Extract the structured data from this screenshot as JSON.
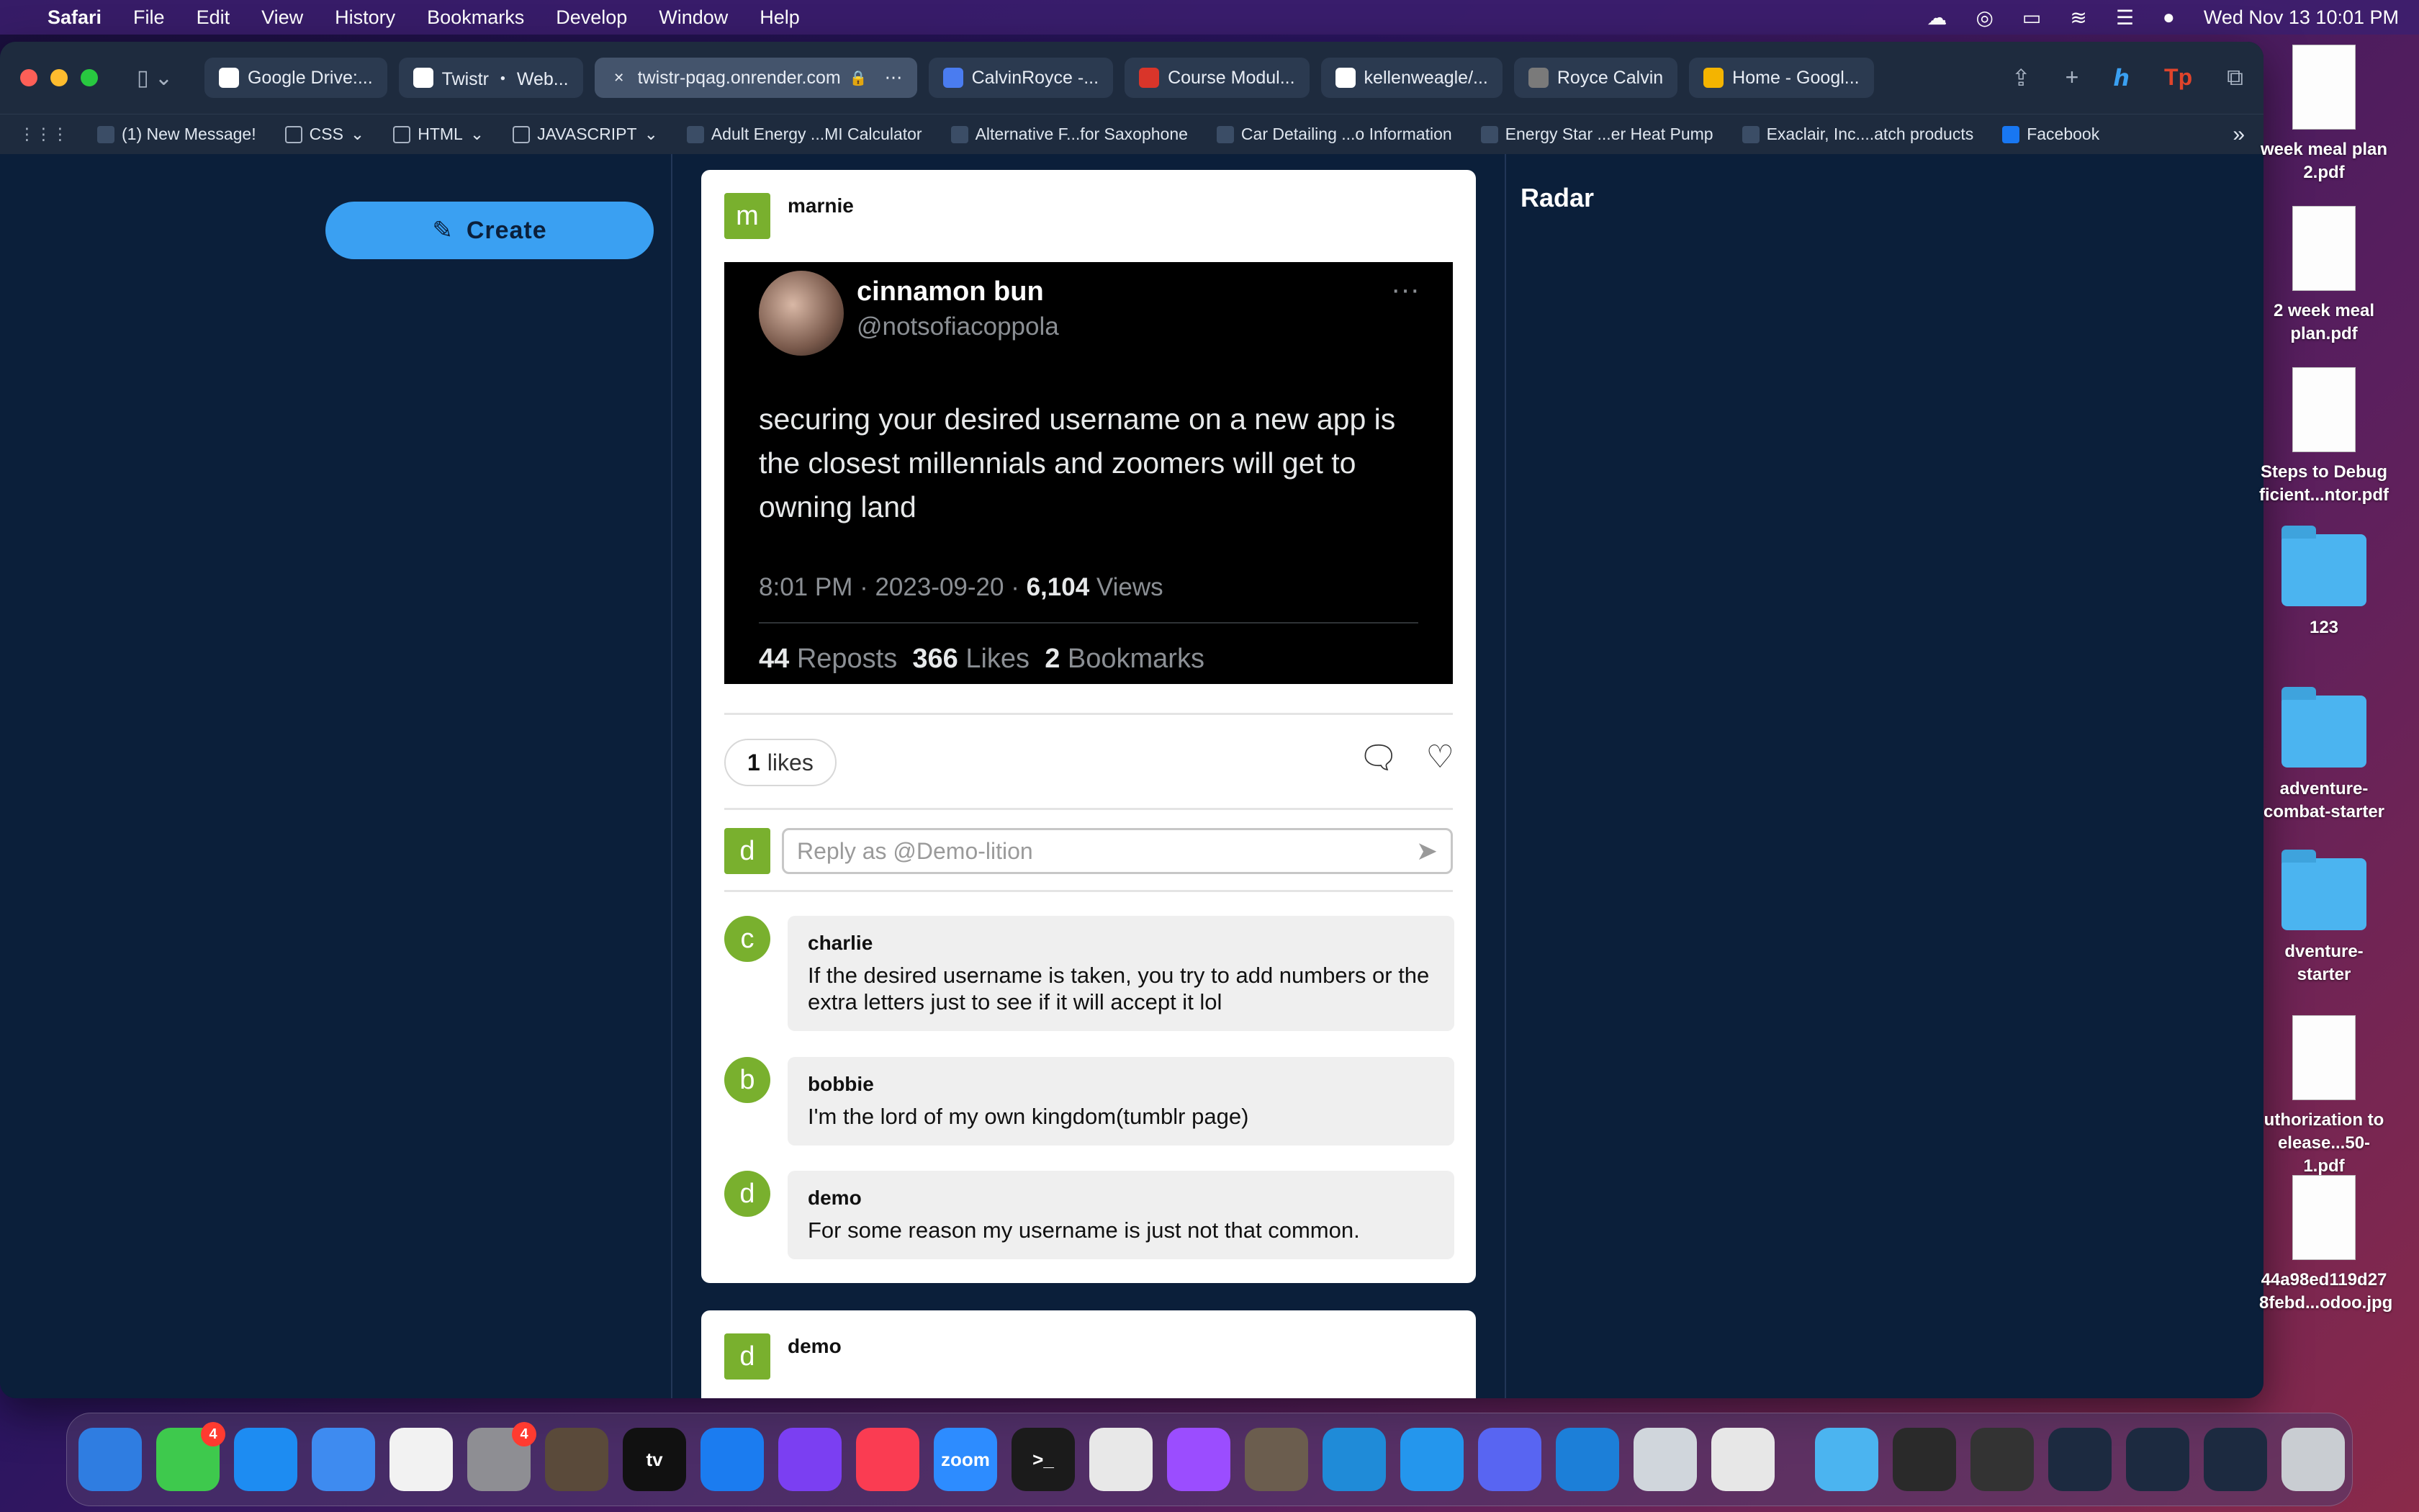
{
  "menubar": {
    "app_name": "Safari",
    "menus": [
      "File",
      "Edit",
      "View",
      "History",
      "Bookmarks",
      "Develop",
      "Window",
      "Help"
    ],
    "datetime": "Wed Nov 13  10:01 PM"
  },
  "tabs": [
    {
      "label": "Google Drive:...",
      "icon": "google-icon",
      "color": "#ffffff"
    },
    {
      "label": "Twistr ・ Web...",
      "icon": "twistr-icon",
      "color": "#ffffff"
    },
    {
      "label": "twistr-pqag.onrender.com",
      "icon": "close-icon",
      "color": "#44546c",
      "active": true
    },
    {
      "label": "CalvinRoyce -...",
      "icon": "docs-icon",
      "color": "#4a7cf0"
    },
    {
      "label": "Course Modul...",
      "icon": "course-icon",
      "color": "#d9352a"
    },
    {
      "label": "kellenweagle/...",
      "icon": "github-icon",
      "color": "#ffffff"
    },
    {
      "label": "Royce Calvin",
      "icon": "g-icon",
      "color": "#7a7a7a"
    },
    {
      "label": "Home - Googl...",
      "icon": "google-drive-icon",
      "color": "#f4b400"
    }
  ],
  "bookmarks": [
    {
      "label": "(1) New Message!",
      "icon": "message-icon"
    },
    {
      "label": "CSS",
      "icon": "folder-icon",
      "folder": true
    },
    {
      "label": "HTML",
      "icon": "folder-icon",
      "folder": true
    },
    {
      "label": "JAVASCRIPT",
      "icon": "folder-icon",
      "folder": true
    },
    {
      "label": "Adult Energy ...MI Calculator",
      "icon": "globe-icon"
    },
    {
      "label": "Alternative F...for Saxophone",
      "icon": "page-icon"
    },
    {
      "label": "Car Detailing ...o Information",
      "icon": "page-icon"
    },
    {
      "label": "Energy Star ...er Heat Pump",
      "icon": "page-icon"
    },
    {
      "label": "Exaclair, Inc....atch products",
      "icon": "page-icon"
    },
    {
      "label": "Facebook",
      "icon": "facebook-icon"
    }
  ],
  "page": {
    "create_label": "Create",
    "radar_title": "Radar"
  },
  "post": {
    "author_initial": "m",
    "author": "marnie",
    "tweet": {
      "name": "cinnamon bun",
      "handle": "@notsofiacoppola",
      "text": "securing your desired username on a new app is the closest millennials and zoomers will get to owning land",
      "meta_prefix": "8:01 PM · 2023-09-20 · ",
      "views_count": "6,104",
      "views_label": " Views",
      "reposts_count": "44",
      "reposts_label": " Reposts",
      "likes_count": "366",
      "likes_label": " Likes",
      "bookmarks_count": "2",
      "bookmarks_label": " Bookmarks"
    },
    "likes_count": "1",
    "likes_label": "likes",
    "reply_initial": "d",
    "reply_placeholder": "Reply as @Demo-lition",
    "comments": [
      {
        "initial": "c",
        "name": "charlie",
        "text": "If the desired username is taken, you try to add numbers or the extra letters just to see if it will accept it lol"
      },
      {
        "initial": "b",
        "name": "bobbie",
        "text": "I'm the lord of my own kingdom(tumblr page)"
      },
      {
        "initial": "d",
        "name": "demo",
        "text": "For some reason my username is just not that common."
      }
    ]
  },
  "next_post": {
    "author_initial": "d",
    "author": "demo"
  },
  "desktop": [
    {
      "label": "week meal plan 2.pdf",
      "kind": "doc"
    },
    {
      "label": "2 week meal plan.pdf",
      "kind": "doc"
    },
    {
      "label": "Steps to Debug ficient...ntor.pdf",
      "kind": "doc"
    },
    {
      "label": "123",
      "kind": "folder"
    },
    {
      "label": "adventure-combat-starter",
      "kind": "folder"
    },
    {
      "label": "dventure-starter",
      "kind": "folder"
    },
    {
      "label": "uthorization to elease...50-1.pdf",
      "kind": "doc"
    },
    {
      "label": "44a98ed119d27 8febd...odoo.jpg",
      "kind": "image"
    }
  ],
  "dock": {
    "apps": [
      {
        "name": "finder",
        "color": "#2f7de1"
      },
      {
        "name": "messages",
        "color": "#3ec94d",
        "badge": "4"
      },
      {
        "name": "safari",
        "color": "#1d8cf2"
      },
      {
        "name": "mail",
        "color": "#3e8bf0"
      },
      {
        "name": "photos",
        "color": "#f2f2f2"
      },
      {
        "name": "system-settings",
        "color": "#8e8e93",
        "badge": "4"
      },
      {
        "name": "screenshot",
        "color": "#5a4a3a"
      },
      {
        "name": "apple-tv",
        "color": "#111111",
        "text": "tv"
      },
      {
        "name": "app-store",
        "color": "#1b7cf0"
      },
      {
        "name": "feedback",
        "color": "#7b3ff2"
      },
      {
        "name": "music",
        "color": "#fa3c52"
      },
      {
        "name": "zoom",
        "color": "#2d8cff",
        "text": "zoom"
      },
      {
        "name": "terminal",
        "color": "#1b1b1b",
        "text": ">_"
      },
      {
        "name": "chrome",
        "color": "#e8e8e8"
      },
      {
        "name": "messenger",
        "color": "#9b4dff"
      },
      {
        "name": "clock",
        "color": "#6b5d4e"
      },
      {
        "name": "vscode",
        "color": "#1f8bd8"
      },
      {
        "name": "docker",
        "color": "#2496ed"
      },
      {
        "name": "discord",
        "color": "#5865f2"
      },
      {
        "name": "jetbrains",
        "color": "#1c7fd8"
      },
      {
        "name": "postgres",
        "color": "#d0d6dc"
      },
      {
        "name": "roblox",
        "color": "#e7e7e7"
      }
    ],
    "recents": [
      {
        "name": "folder-recent",
        "color": "#4bb4f0"
      },
      {
        "name": "window-recent-1",
        "color": "#2a2a2a"
      },
      {
        "name": "window-recent-2",
        "color": "#333333"
      },
      {
        "name": "window-recent-3",
        "color": "#1c2a40"
      },
      {
        "name": "window-recent-4",
        "color": "#1c2a40"
      },
      {
        "name": "window-recent-5",
        "color": "#1c2a40"
      },
      {
        "name": "trash",
        "color": "#c9cdd2"
      }
    ]
  }
}
